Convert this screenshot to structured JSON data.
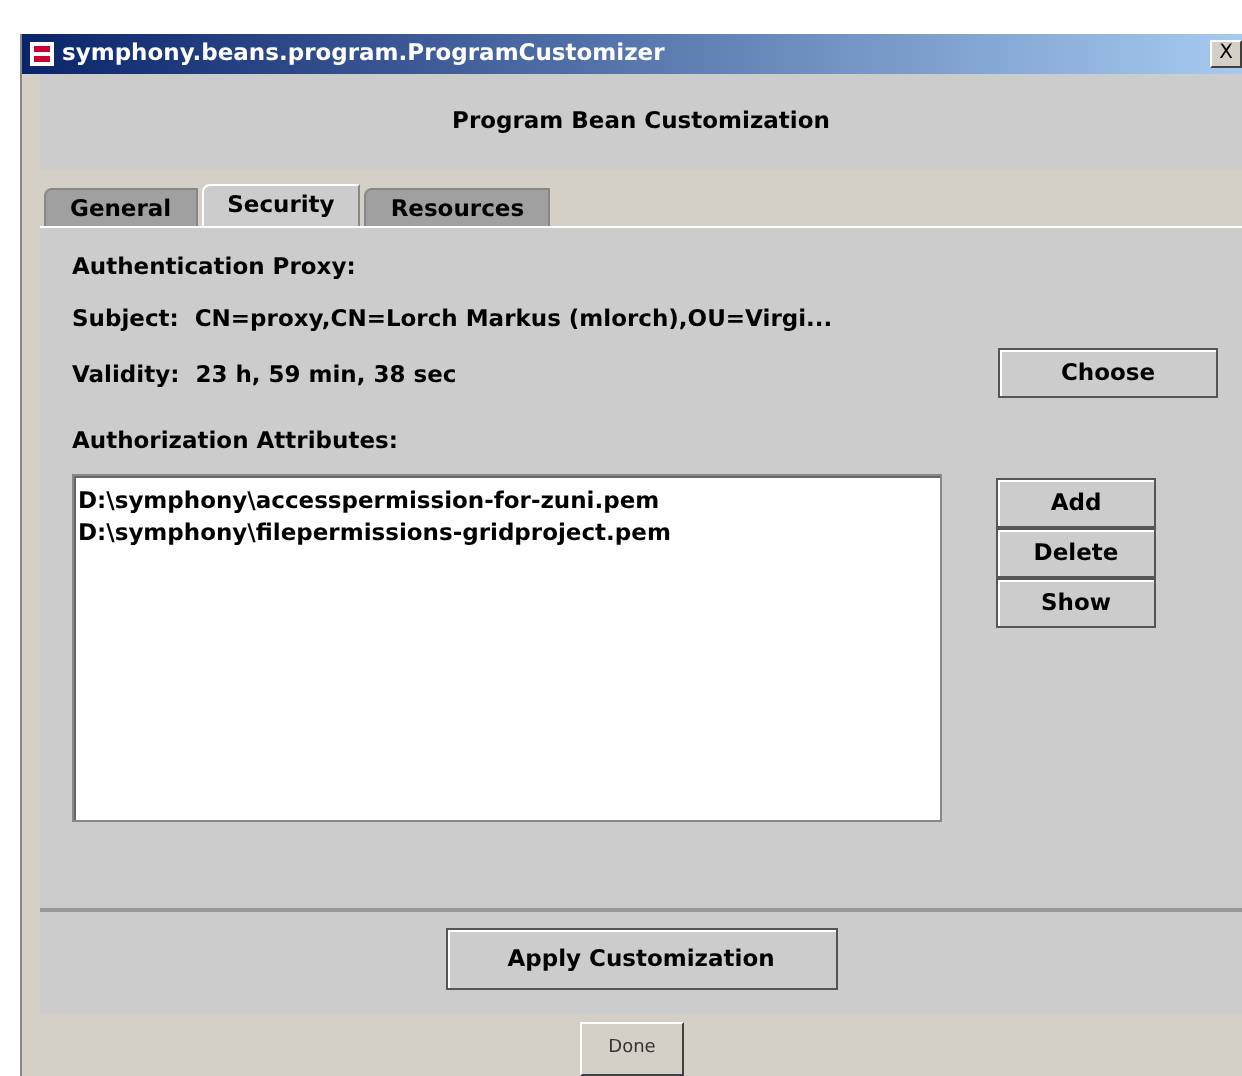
{
  "window": {
    "title": "symphony.beans.program.ProgramCustomizer",
    "close": "X"
  },
  "header": "Program Bean Customization",
  "tabs": [
    {
      "label": "General",
      "selected": false
    },
    {
      "label": "Security",
      "selected": true
    },
    {
      "label": "Resources",
      "selected": false
    }
  ],
  "section_title": "Authentication Proxy:",
  "subject": {
    "label": "Subject:",
    "value": "CN=proxy,CN=Lorch Markus (mlorch),OU=Virgi..."
  },
  "validity": {
    "label": "Validity:",
    "value": "23 h, 59 min, 38 sec"
  },
  "choose_button": "Choose",
  "attributes_title": "Authorization Attributes:",
  "attributes": [
    "D:\\symphony\\accesspermission-for-zuni.pem",
    "D:\\symphony\\filepermissions-gridproject.pem"
  ],
  "attribute_buttons": [
    "Add",
    "Delete",
    "Show"
  ],
  "apply_button": "Apply Customization",
  "done_button": "Done"
}
